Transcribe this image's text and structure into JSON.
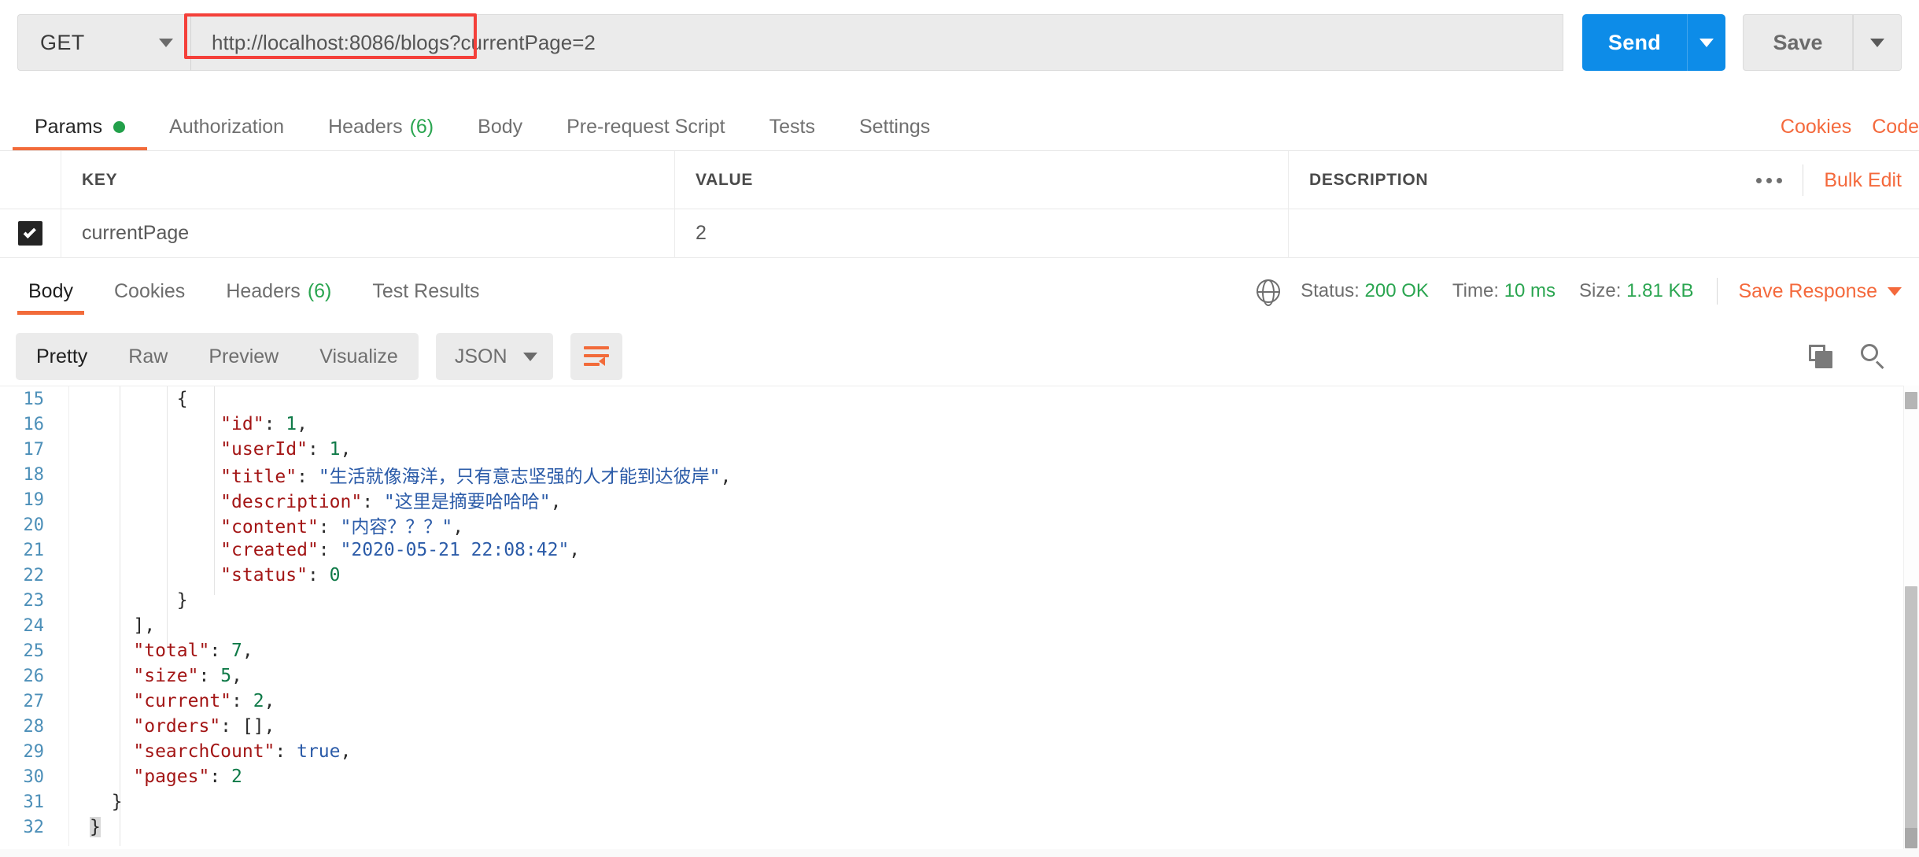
{
  "request_bar": {
    "method": "GET",
    "method_caret_icon": "chevron-down-icon",
    "url": "http://localhost:8086/blogs?currentPage=2",
    "url_highlight_color": "#f4403a",
    "send_label": "Send",
    "send_caret_icon": "chevron-down-icon",
    "send_color": "#0d8ce8",
    "save_label": "Save",
    "save_caret_icon": "chevron-down-icon"
  },
  "request_tabs": {
    "items": [
      {
        "label": "Params",
        "active": true,
        "dot": true
      },
      {
        "label": "Authorization",
        "active": false
      },
      {
        "label": "Headers",
        "count": "(6)",
        "active": false
      },
      {
        "label": "Body",
        "active": false
      },
      {
        "label": "Pre-request Script",
        "active": false
      },
      {
        "label": "Tests",
        "active": false
      },
      {
        "label": "Settings",
        "active": false
      }
    ],
    "right_links": [
      {
        "label": "Cookies"
      },
      {
        "label": "Code"
      }
    ],
    "accent_color": "#f26b3a",
    "dot_color": "#22a04a"
  },
  "params_table": {
    "headers": [
      "KEY",
      "VALUE",
      "DESCRIPTION"
    ],
    "more_icon": "ellipsis-icon",
    "bulk_edit_label": "Bulk Edit",
    "rows": [
      {
        "checked": true,
        "key": "currentPage",
        "value": "2",
        "description": ""
      }
    ]
  },
  "response_tabs": {
    "items": [
      {
        "label": "Body",
        "active": true
      },
      {
        "label": "Cookies",
        "active": false
      },
      {
        "label": "Headers",
        "count": "(6)",
        "active": false
      },
      {
        "label": "Test Results",
        "active": false
      }
    ],
    "globe_icon": "globe-icon",
    "status_label": "Status:",
    "status_value": "200 OK",
    "time_label": "Time:",
    "time_value": "10 ms",
    "size_label": "Size:",
    "size_value": "1.81 KB",
    "save_response_label": "Save Response",
    "save_response_caret_icon": "chevron-down-icon",
    "success_color": "#2aa550"
  },
  "format_toolbar": {
    "view_modes": [
      {
        "label": "Pretty",
        "active": true
      },
      {
        "label": "Raw",
        "active": false
      },
      {
        "label": "Preview",
        "active": false
      },
      {
        "label": "Visualize",
        "active": false
      }
    ],
    "language": "JSON",
    "language_caret_icon": "chevron-down-icon",
    "wrap_icon": "word-wrap-icon",
    "copy_icon": "copy-icon",
    "search_icon": "search-icon"
  },
  "code_viewer": {
    "first_line_number": 15,
    "lines": [
      {
        "num": 15,
        "tokens": [
          {
            "t": "        {",
            "c": "p"
          }
        ]
      },
      {
        "num": 16,
        "tokens": [
          {
            "t": "            ",
            "c": "p"
          },
          {
            "t": "\"id\"",
            "c": "k"
          },
          {
            "t": ": ",
            "c": "p"
          },
          {
            "t": "1",
            "c": "n"
          },
          {
            "t": ",",
            "c": "p"
          }
        ]
      },
      {
        "num": 17,
        "tokens": [
          {
            "t": "            ",
            "c": "p"
          },
          {
            "t": "\"userId\"",
            "c": "k"
          },
          {
            "t": ": ",
            "c": "p"
          },
          {
            "t": "1",
            "c": "n"
          },
          {
            "t": ",",
            "c": "p"
          }
        ]
      },
      {
        "num": 18,
        "tokens": [
          {
            "t": "            ",
            "c": "p"
          },
          {
            "t": "\"title\"",
            "c": "k"
          },
          {
            "t": ": ",
            "c": "p"
          },
          {
            "t": "\"生活就像海洋，只有意志坚强的人才能到达彼岸\"",
            "c": "s"
          },
          {
            "t": ",",
            "c": "p"
          }
        ]
      },
      {
        "num": 19,
        "tokens": [
          {
            "t": "            ",
            "c": "p"
          },
          {
            "t": "\"description\"",
            "c": "k"
          },
          {
            "t": ": ",
            "c": "p"
          },
          {
            "t": "\"这里是摘要哈哈哈\"",
            "c": "s"
          },
          {
            "t": ",",
            "c": "p"
          }
        ]
      },
      {
        "num": 20,
        "tokens": [
          {
            "t": "            ",
            "c": "p"
          },
          {
            "t": "\"content\"",
            "c": "k"
          },
          {
            "t": ": ",
            "c": "p"
          },
          {
            "t": "\"内容？？？\"",
            "c": "s"
          },
          {
            "t": ",",
            "c": "p"
          }
        ]
      },
      {
        "num": 21,
        "tokens": [
          {
            "t": "            ",
            "c": "p"
          },
          {
            "t": "\"created\"",
            "c": "k"
          },
          {
            "t": ": ",
            "c": "p"
          },
          {
            "t": "\"2020-05-21 22:08:42\"",
            "c": "s"
          },
          {
            "t": ",",
            "c": "p"
          }
        ]
      },
      {
        "num": 22,
        "tokens": [
          {
            "t": "            ",
            "c": "p"
          },
          {
            "t": "\"status\"",
            "c": "k"
          },
          {
            "t": ": ",
            "c": "p"
          },
          {
            "t": "0",
            "c": "n"
          }
        ]
      },
      {
        "num": 23,
        "tokens": [
          {
            "t": "        }",
            "c": "p"
          }
        ]
      },
      {
        "num": 24,
        "tokens": [
          {
            "t": "    ],",
            "c": "p"
          }
        ]
      },
      {
        "num": 25,
        "tokens": [
          {
            "t": "    ",
            "c": "p"
          },
          {
            "t": "\"total\"",
            "c": "k"
          },
          {
            "t": ": ",
            "c": "p"
          },
          {
            "t": "7",
            "c": "n"
          },
          {
            "t": ",",
            "c": "p"
          }
        ]
      },
      {
        "num": 26,
        "tokens": [
          {
            "t": "    ",
            "c": "p"
          },
          {
            "t": "\"size\"",
            "c": "k"
          },
          {
            "t": ": ",
            "c": "p"
          },
          {
            "t": "5",
            "c": "n"
          },
          {
            "t": ",",
            "c": "p"
          }
        ]
      },
      {
        "num": 27,
        "tokens": [
          {
            "t": "    ",
            "c": "p"
          },
          {
            "t": "\"current\"",
            "c": "k"
          },
          {
            "t": ": ",
            "c": "p"
          },
          {
            "t": "2",
            "c": "n"
          },
          {
            "t": ",",
            "c": "p"
          }
        ]
      },
      {
        "num": 28,
        "tokens": [
          {
            "t": "    ",
            "c": "p"
          },
          {
            "t": "\"orders\"",
            "c": "k"
          },
          {
            "t": ": ",
            "c": "p"
          },
          {
            "t": "[],",
            "c": "p"
          }
        ]
      },
      {
        "num": 29,
        "tokens": [
          {
            "t": "    ",
            "c": "p"
          },
          {
            "t": "\"searchCount\"",
            "c": "k"
          },
          {
            "t": ": ",
            "c": "p"
          },
          {
            "t": "true",
            "c": "b"
          },
          {
            "t": ",",
            "c": "p"
          }
        ]
      },
      {
        "num": 30,
        "tokens": [
          {
            "t": "    ",
            "c": "p"
          },
          {
            "t": "\"pages\"",
            "c": "k"
          },
          {
            "t": ": ",
            "c": "p"
          },
          {
            "t": "2",
            "c": "n"
          }
        ]
      },
      {
        "num": 31,
        "tokens": [
          {
            "t": "  }",
            "c": "p"
          }
        ]
      },
      {
        "num": 32,
        "tokens": [
          {
            "t": "}",
            "c": "p"
          }
        ]
      }
    ],
    "syntax_colors": {
      "key": "#a31515",
      "string": "#2b5ba8",
      "number": "#0f7a48",
      "boolean": "#2b5ba8",
      "punctuation": "#2a2a2a",
      "line_number": "#4c8fb8"
    }
  }
}
